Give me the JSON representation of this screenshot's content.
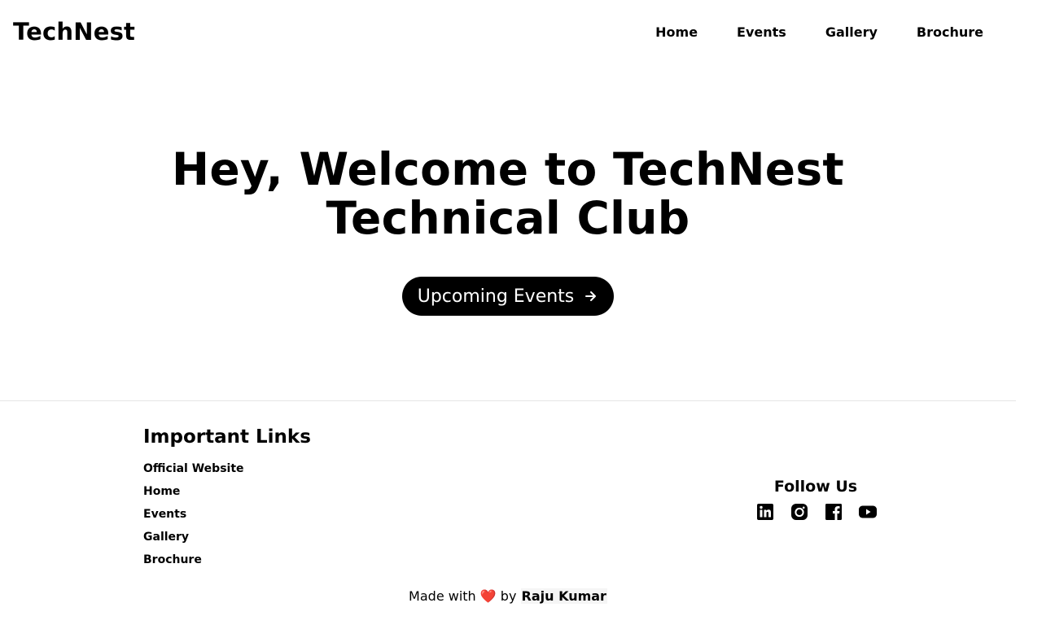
{
  "brand": {
    "name": "TechNest"
  },
  "nav": {
    "items": [
      {
        "label": "Home"
      },
      {
        "label": "Events"
      },
      {
        "label": "Gallery"
      },
      {
        "label": "Brochure"
      }
    ]
  },
  "hero": {
    "title_line1": "Hey, Welcome to TechNest",
    "title_line2": "Technical Club",
    "cta_label": "Upcoming Events",
    "cta_icon": "arrow-right-icon"
  },
  "footer": {
    "links_heading": "Important Links",
    "links": [
      {
        "label": "Official Website"
      },
      {
        "label": "Home"
      },
      {
        "label": "Events"
      },
      {
        "label": "Gallery"
      },
      {
        "label": "Brochure"
      }
    ],
    "follow_heading": "Follow Us",
    "social": [
      "linkedin-icon",
      "instagram-icon",
      "facebook-icon",
      "youtube-icon"
    ],
    "credit_prefix": "Made with",
    "credit_heart": "❤️",
    "credit_by": "by",
    "credit_author": "Raju Kumar"
  },
  "colors": {
    "primary": "#000000",
    "background": "#ffffff",
    "heart": "#e0322c"
  }
}
